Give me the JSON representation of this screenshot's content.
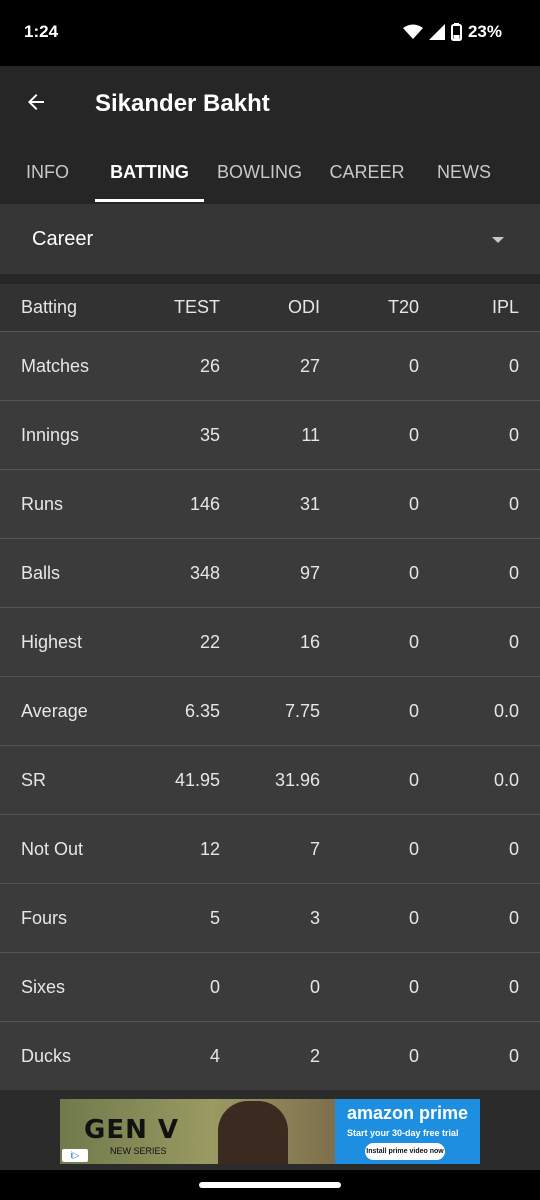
{
  "status": {
    "time": "1:24",
    "battery": "23%"
  },
  "header": {
    "title": "Sikander Bakht"
  },
  "tabs": [
    {
      "label": "INFO",
      "active": false
    },
    {
      "label": "BATTING",
      "active": true
    },
    {
      "label": "BOWLING",
      "active": false
    },
    {
      "label": "CAREER",
      "active": false
    },
    {
      "label": "NEWS",
      "active": false
    }
  ],
  "filter": {
    "selected": "Career"
  },
  "table": {
    "headers": [
      "Batting",
      "TEST",
      "ODI",
      "T20",
      "IPL"
    ],
    "rows": [
      [
        "Matches",
        "26",
        "27",
        "0",
        "0"
      ],
      [
        "Innings",
        "35",
        "11",
        "0",
        "0"
      ],
      [
        "Runs",
        "146",
        "31",
        "0",
        "0"
      ],
      [
        "Balls",
        "348",
        "97",
        "0",
        "0"
      ],
      [
        "Highest",
        "22",
        "16",
        "0",
        "0"
      ],
      [
        "Average",
        "6.35",
        "7.75",
        "0",
        "0.0"
      ],
      [
        "SR",
        "41.95",
        "31.96",
        "0",
        "0.0"
      ],
      [
        "Not Out",
        "12",
        "7",
        "0",
        "0"
      ],
      [
        "Fours",
        "5",
        "3",
        "0",
        "0"
      ],
      [
        "Sixes",
        "0",
        "0",
        "0",
        "0"
      ],
      [
        "Ducks",
        "4",
        "2",
        "0",
        "0"
      ]
    ]
  },
  "ad": {
    "title": "GEN V",
    "subtitle": "NEW SERIES",
    "brand": "amazon prime",
    "tagline": "Start your 30-day free trial",
    "cta": "Install prime video now"
  }
}
